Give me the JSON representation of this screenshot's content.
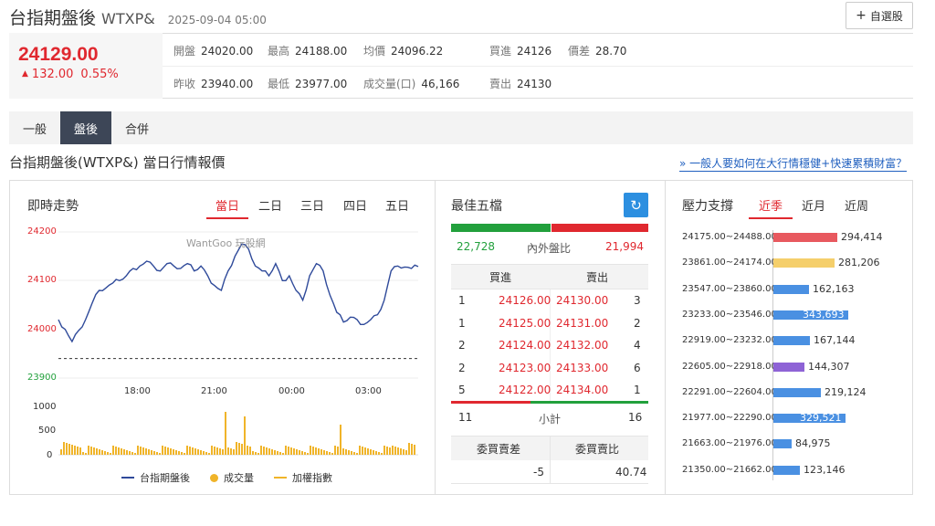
{
  "header": {
    "name": "台指期盤後",
    "code": "WTXP&",
    "datetime": "2025-09-04 05:00",
    "add_button_icon": "plus-icon",
    "add_button_label": "自選股"
  },
  "quote": {
    "price": "24129.00",
    "change": "132.00",
    "change_pct": "0.55%",
    "change_arrow": "▲",
    "color_up": "#e0282f",
    "fields": {
      "open": {
        "label": "開盤",
        "value": "24020.00"
      },
      "high": {
        "label": "最高",
        "value": "24188.00"
      },
      "avg": {
        "label": "均價",
        "value": "24096.22"
      },
      "bid": {
        "label": "買進",
        "value": "24126"
      },
      "spread": {
        "label": "價差",
        "value": "28.70"
      },
      "prev_close": {
        "label": "昨收",
        "value": "23940.00"
      },
      "low": {
        "label": "最低",
        "value": "23977.00"
      },
      "volume": {
        "label": "成交量(口)",
        "value": "46,166"
      },
      "ask": {
        "label": "賣出",
        "value": "24130"
      }
    }
  },
  "tabs": [
    {
      "label": "一般",
      "active": false
    },
    {
      "label": "盤後",
      "active": true
    },
    {
      "label": "合併",
      "active": false
    }
  ],
  "section_title": "台指期盤後(WTXP&) 當日行情報價",
  "promo_link": "» 一般人要如何在大行情穩健+快速累積財富？",
  "intraday": {
    "title": "即時走勢",
    "ranges": [
      {
        "label": "當日",
        "active": true
      },
      {
        "label": "二日",
        "active": false
      },
      {
        "label": "三日",
        "active": false
      },
      {
        "label": "四日",
        "active": false
      },
      {
        "label": "五日",
        "active": false
      }
    ],
    "watermark": "WantGoo 玩股網",
    "legend": {
      "price": "台指期盤後",
      "volume": "成交量",
      "weighted": "加權指數"
    }
  },
  "chart_data": {
    "type": "line",
    "y_ticks": [
      "24200",
      "24100",
      "24000",
      "23900"
    ],
    "ylim": [
      23900,
      24200
    ],
    "reference_line": 23940,
    "x_ticks": [
      "18:00",
      "21:00",
      "00:00",
      "03:00"
    ],
    "volume_ticks": [
      "1000",
      "500",
      "0"
    ],
    "volume_ylim": [
      0,
      1000
    ],
    "series": [
      {
        "name": "台指期盤後",
        "color": "#2f4a9a",
        "values": [
          24020,
          24000,
          23975,
          23998,
          24020,
          24055,
          24080,
          24085,
          24095,
          24100,
          24110,
          24125,
          24130,
          24140,
          24130,
          24120,
          24135,
          24130,
          24125,
          24135,
          24120,
          24130,
          24110,
          24090,
          24080,
          24120,
          24150,
          24175,
          24165,
          24130,
          24120,
          24110,
          24135,
          24100,
          24110,
          24080,
          24060,
          24110,
          24135,
          24120,
          24070,
          24035,
          24015,
          24025,
          24020,
          24010,
          24020,
          24030,
          24060,
          24120,
          24130,
          24128,
          24125,
          24129
        ]
      }
    ]
  },
  "best_five": {
    "title": "最佳五檔",
    "refresh_icon": "refresh-icon",
    "inner_volume": "22,728",
    "ratio_label": "內外盤比",
    "outer_volume": "21,994",
    "inner_color": "#22a03c",
    "outer_color": "#e0282f",
    "bid_header": "買進",
    "ask_header": "賣出",
    "rows": [
      {
        "bid_qty": "1",
        "bid": "24126.00",
        "ask": "24130.00",
        "ask_qty": "3"
      },
      {
        "bid_qty": "1",
        "bid": "24125.00",
        "ask": "24131.00",
        "ask_qty": "2"
      },
      {
        "bid_qty": "2",
        "bid": "24124.00",
        "ask": "24132.00",
        "ask_qty": "4"
      },
      {
        "bid_qty": "2",
        "bid": "24123.00",
        "ask": "24133.00",
        "ask_qty": "6"
      },
      {
        "bid_qty": "5",
        "bid": "24122.00",
        "ask": "24134.00",
        "ask_qty": "1"
      }
    ],
    "subtotal_bid": "11",
    "subtotal_label": "小計",
    "subtotal_ask": "16",
    "gap_label": "委買賣差",
    "ratio2_label": "委買賣比",
    "gap_value": "-5",
    "ratio2_value": "40.74"
  },
  "pressure": {
    "title": "壓力支撐",
    "ranges": [
      {
        "label": "近季",
        "active": true
      },
      {
        "label": "近月",
        "active": false
      },
      {
        "label": "近周",
        "active": false
      }
    ],
    "max_value": 343693,
    "levels": [
      {
        "range": "24175.00~24488.00",
        "value": "294,414",
        "num": 294414,
        "color": "#e8595f"
      },
      {
        "range": "23861.00~24174.00",
        "value": "281,206",
        "num": 281206,
        "color": "#f5cf6b"
      },
      {
        "range": "23547.00~23860.00",
        "value": "162,163",
        "num": 162163,
        "color": "#4a90e2"
      },
      {
        "range": "23233.00~23546.00",
        "value": "343,693",
        "num": 343693,
        "color": "#4a90e2"
      },
      {
        "range": "22919.00~23232.00",
        "value": "167,144",
        "num": 167144,
        "color": "#4a90e2"
      },
      {
        "range": "22605.00~22918.00",
        "value": "144,307",
        "num": 144307,
        "color": "#8e63d6"
      },
      {
        "range": "22291.00~22604.00",
        "value": "219,124",
        "num": 219124,
        "color": "#4a90e2"
      },
      {
        "range": "21977.00~22290.00",
        "value": "329,521",
        "num": 329521,
        "color": "#4a90e2"
      },
      {
        "range": "21663.00~21976.00",
        "value": "84,975",
        "num": 84975,
        "color": "#4a90e2"
      },
      {
        "range": "21350.00~21662.00",
        "value": "123,146",
        "num": 123146,
        "color": "#4a90e2"
      }
    ]
  }
}
